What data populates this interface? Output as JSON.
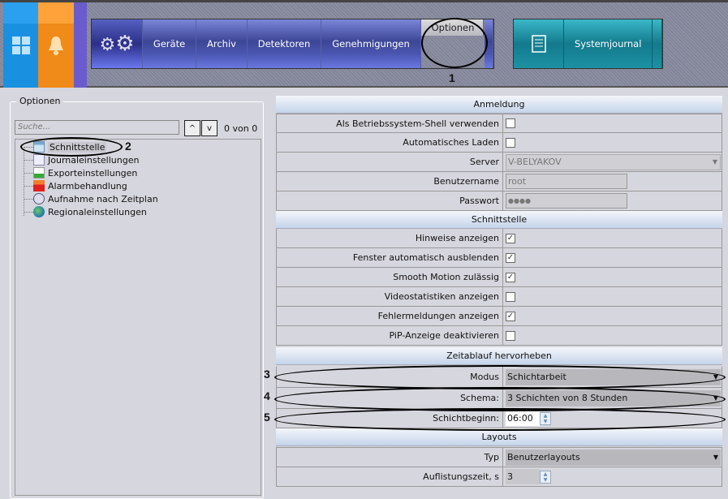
{
  "topbar": {
    "nav_items": [
      "Geräte",
      "Archiv",
      "Detektoren",
      "Genehmigungen",
      "Optionen"
    ],
    "selected": "Optionen",
    "systemjournal": "Systemjournal"
  },
  "left": {
    "group_title": "Optionen",
    "search_placeholder": "Suche...",
    "counter": "0 von 0",
    "up": "^",
    "down": "v",
    "tree": [
      "Schnittstelle",
      "Journaleinstellungen",
      "Exporteinstellungen",
      "Alarmbehandlung",
      "Aufnahme nach Zeitplan",
      "Regionaleinstellungen"
    ]
  },
  "sections": {
    "anmeldung": {
      "title": "Anmeldung",
      "shell": "Als Betriebssystem-Shell verwenden",
      "autoload": "Automatisches Laden",
      "server_label": "Server",
      "server": "V-BELYAKOV",
      "user_label": "Benutzername",
      "user": "root",
      "pw_label": "Passwort",
      "pw": "●●●●"
    },
    "schnittstelle": {
      "title": "Schnittstelle",
      "rows": [
        {
          "label": "Hinweise anzeigen",
          "checked": true
        },
        {
          "label": "Fenster automatisch ausblenden",
          "checked": true
        },
        {
          "label": "Smooth Motion zulässig",
          "checked": true
        },
        {
          "label": "Videostatistiken anzeigen",
          "checked": false
        },
        {
          "label": "Fehlermeldungen anzeigen",
          "checked": true
        },
        {
          "label": "PiP-Anzeige deaktivieren",
          "checked": false
        }
      ]
    },
    "zeit": {
      "title": "Zeitablauf hervorheben",
      "modus_label": "Modus",
      "modus": "Schichtarbeit",
      "schema_label": "Schema:",
      "schema": "3 Schichten von 8 Stunden",
      "beginn_label": "Schichtbeginn:",
      "beginn": "06:00"
    },
    "layouts": {
      "title": "Layouts",
      "typ_label": "Typ",
      "typ": "Benutzerlayouts",
      "zeit_label": "Auflistungszeit, s",
      "zeit": "3"
    }
  },
  "annotations": [
    "1",
    "2",
    "3",
    "4",
    "5"
  ],
  "check_mark": "✓"
}
